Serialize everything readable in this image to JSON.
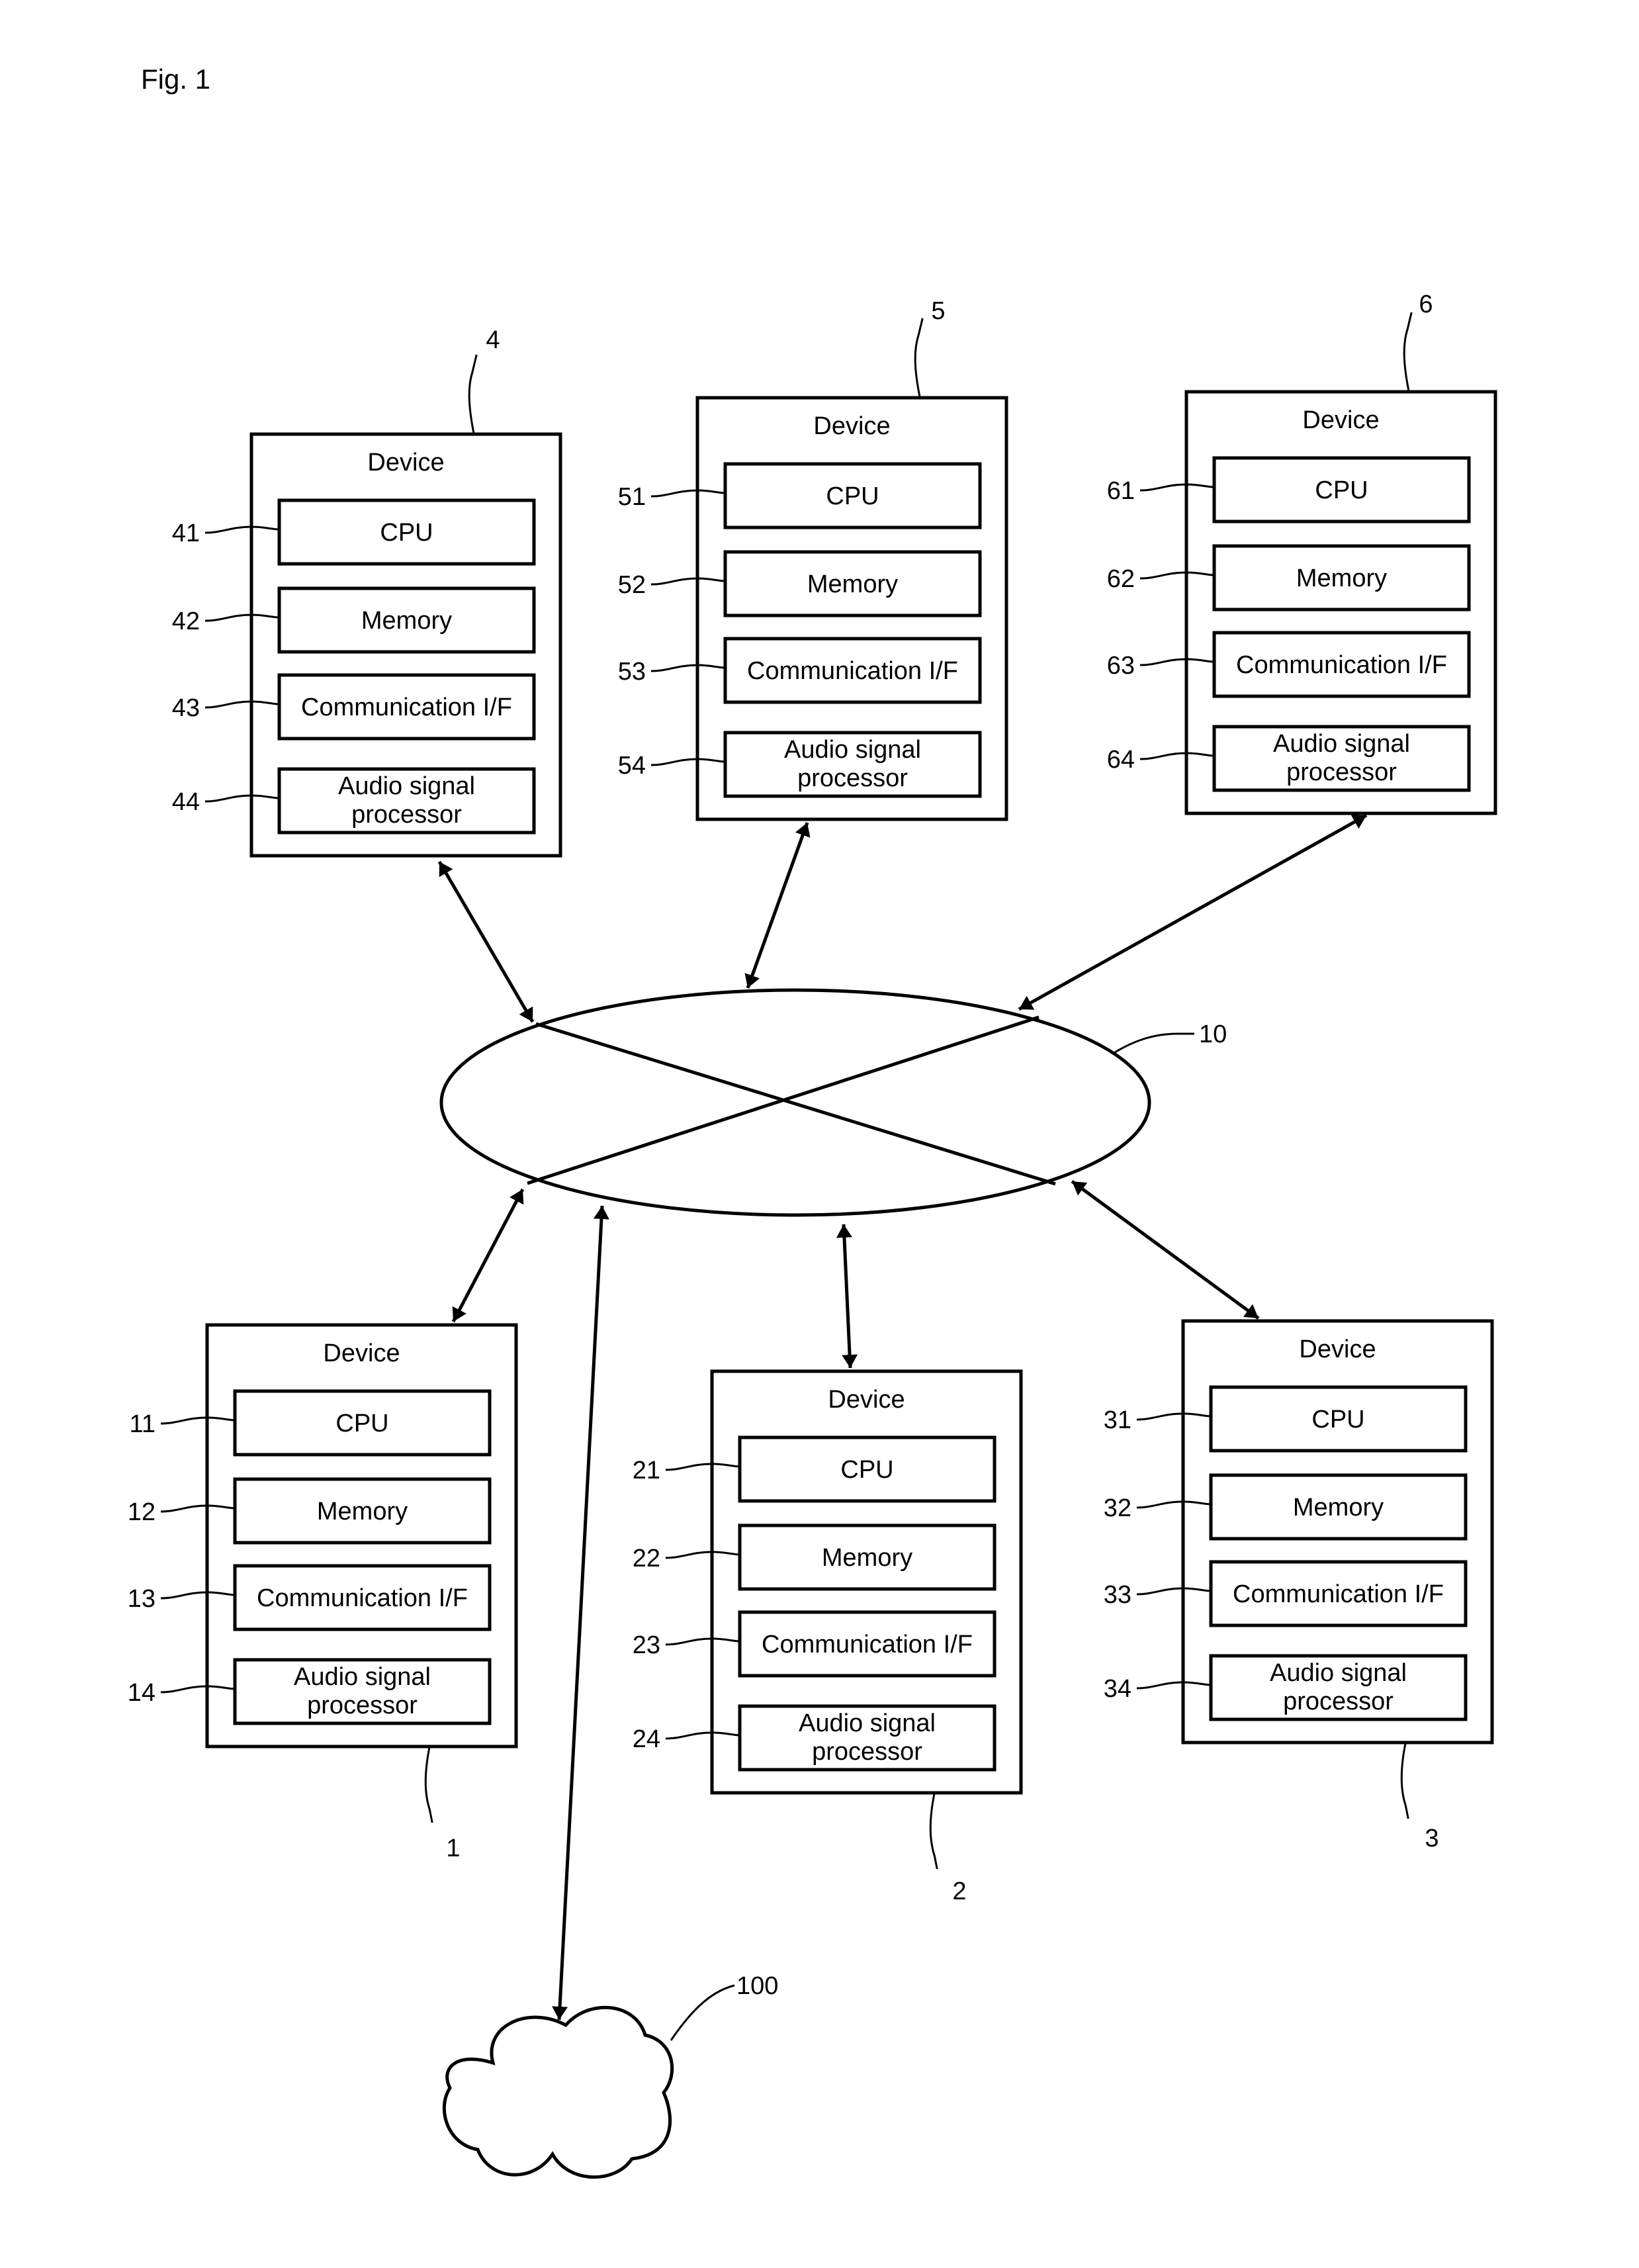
{
  "figure_label": "Fig. 1",
  "network": {
    "ref": "10"
  },
  "cloud": {
    "ref": "100"
  },
  "devices": [
    {
      "ref": "4",
      "title": "Device",
      "components": [
        {
          "ref": "41",
          "label": [
            "CPU"
          ]
        },
        {
          "ref": "42",
          "label": [
            "Memory"
          ]
        },
        {
          "ref": "43",
          "label": [
            "Communication I/F"
          ]
        },
        {
          "ref": "44",
          "label": [
            "Audio signal",
            "processor"
          ]
        }
      ]
    },
    {
      "ref": "5",
      "title": "Device",
      "components": [
        {
          "ref": "51",
          "label": [
            "CPU"
          ]
        },
        {
          "ref": "52",
          "label": [
            "Memory"
          ]
        },
        {
          "ref": "53",
          "label": [
            "Communication I/F"
          ]
        },
        {
          "ref": "54",
          "label": [
            "Audio signal",
            "processor"
          ]
        }
      ]
    },
    {
      "ref": "6",
      "title": "Device",
      "components": [
        {
          "ref": "61",
          "label": [
            "CPU"
          ]
        },
        {
          "ref": "62",
          "label": [
            "Memory"
          ]
        },
        {
          "ref": "63",
          "label": [
            "Communication I/F"
          ]
        },
        {
          "ref": "64",
          "label": [
            "Audio signal",
            "processor"
          ]
        }
      ]
    },
    {
      "ref": "1",
      "title": "Device",
      "components": [
        {
          "ref": "11",
          "label": [
            "CPU"
          ]
        },
        {
          "ref": "12",
          "label": [
            "Memory"
          ]
        },
        {
          "ref": "13",
          "label": [
            "Communication I/F"
          ]
        },
        {
          "ref": "14",
          "label": [
            "Audio signal",
            "processor"
          ]
        }
      ]
    },
    {
      "ref": "2",
      "title": "Device",
      "components": [
        {
          "ref": "21",
          "label": [
            "CPU"
          ]
        },
        {
          "ref": "22",
          "label": [
            "Memory"
          ]
        },
        {
          "ref": "23",
          "label": [
            "Communication I/F"
          ]
        },
        {
          "ref": "24",
          "label": [
            "Audio signal",
            "processor"
          ]
        }
      ]
    },
    {
      "ref": "3",
      "title": "Device",
      "components": [
        {
          "ref": "31",
          "label": [
            "CPU"
          ]
        },
        {
          "ref": "32",
          "label": [
            "Memory"
          ]
        },
        {
          "ref": "33",
          "label": [
            "Communication I/F"
          ]
        },
        {
          "ref": "34",
          "label": [
            "Audio signal",
            "processor"
          ]
        }
      ]
    }
  ],
  "connections": [
    {
      "from": "4",
      "to": "10",
      "type": "bidirectional"
    },
    {
      "from": "5",
      "to": "10",
      "type": "bidirectional"
    },
    {
      "from": "6",
      "to": "10",
      "type": "bidirectional"
    },
    {
      "from": "1",
      "to": "10",
      "type": "bidirectional"
    },
    {
      "from": "2",
      "to": "10",
      "type": "bidirectional"
    },
    {
      "from": "3",
      "to": "10",
      "type": "bidirectional"
    },
    {
      "from": "100",
      "to": "10",
      "type": "bidirectional"
    }
  ]
}
